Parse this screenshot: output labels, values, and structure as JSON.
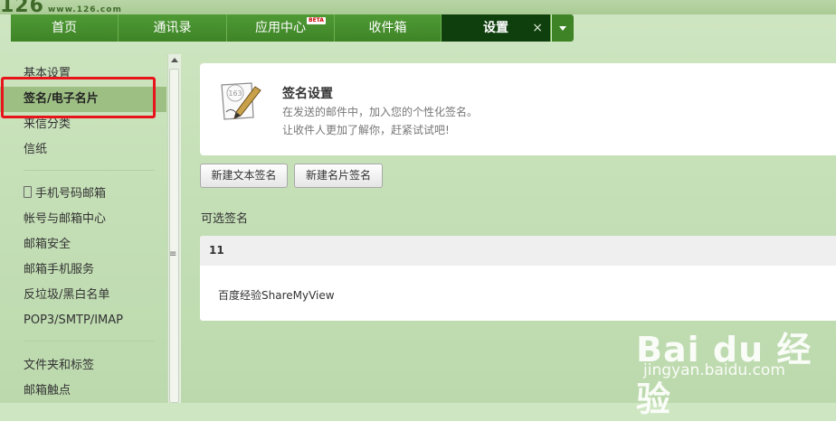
{
  "logo": {
    "mark": "126",
    "url": "www.126.com"
  },
  "nav": {
    "tabs": [
      {
        "label": "首页"
      },
      {
        "label": "通讯录"
      },
      {
        "label": "应用中心",
        "badge": "BETA"
      },
      {
        "label": "收件箱"
      },
      {
        "label": "设置",
        "close": "×"
      }
    ]
  },
  "sidebar": {
    "items": [
      {
        "label": "基本设置"
      },
      {
        "label": "签名/电子名片"
      },
      {
        "label": "来信分类"
      },
      {
        "label": "信纸"
      },
      {
        "label": "手机号码邮箱"
      },
      {
        "label": "帐号与邮箱中心"
      },
      {
        "label": "邮箱安全"
      },
      {
        "label": "邮箱手机服务"
      },
      {
        "label": "反垃圾/黑白名单"
      },
      {
        "label": "POP3/SMTP/IMAP"
      },
      {
        "label": "文件夹和标签"
      },
      {
        "label": "邮箱触点"
      }
    ]
  },
  "main": {
    "card_title": "签名设置",
    "card_desc1": "在发送的邮件中，加入您的个性化签名。",
    "card_desc2": "让收件人更加了解你，赶紧试试吧!",
    "icon_text": "163",
    "buttons": {
      "new_text": "新建文本签名",
      "new_card": "新建名片签名"
    },
    "section_title": "可选签名",
    "signature": {
      "name": "11",
      "content": "百度经验ShareMyView"
    }
  },
  "watermark": {
    "main": "Bai du 经验",
    "sub": "jingyan.baidu.com"
  },
  "colors": {
    "accent": "#3e8427",
    "active_tab": "#0f3f0c",
    "highlight": "#e8141b"
  }
}
